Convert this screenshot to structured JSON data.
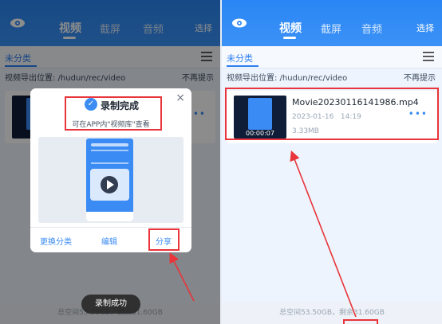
{
  "header": {
    "tabs": [
      {
        "label": "视频",
        "active": true
      },
      {
        "label": "截屏",
        "active": false
      },
      {
        "label": "音频",
        "active": false
      }
    ],
    "select_label": "选择"
  },
  "category": {
    "label": "未分类"
  },
  "export_path": {
    "text": "视频导出位置: /hudun/rec/video",
    "dismiss": "不再提示"
  },
  "video": {
    "filename": "Movie20230116141986.mp4",
    "date": "2023-01-16",
    "time": "14:19",
    "size": "3.33MB",
    "duration": "00:00:07",
    "more": "•••"
  },
  "footer": {
    "storage_left": "总空间53.50GB，剩余31.60GB",
    "storage_right": "总空间53.50GB，剩余31.60GB"
  },
  "dialog": {
    "title": "录制完成",
    "subtitle": "可在APP内\"视频库\"查看",
    "close": "×",
    "buttons": {
      "change_category": "更换分类",
      "edit": "编辑",
      "share": "分享"
    }
  },
  "toast": {
    "text": "录制成功"
  },
  "colors": {
    "accent": "#2b7ef0",
    "header_blue": "#2a86f5",
    "highlight_red": "#e8343a"
  },
  "icons": {
    "logo": "eye-logo-icon",
    "menu": "hamburger-menu-icon",
    "check": "check-circle-icon",
    "close": "close-icon",
    "play": "play-icon"
  }
}
